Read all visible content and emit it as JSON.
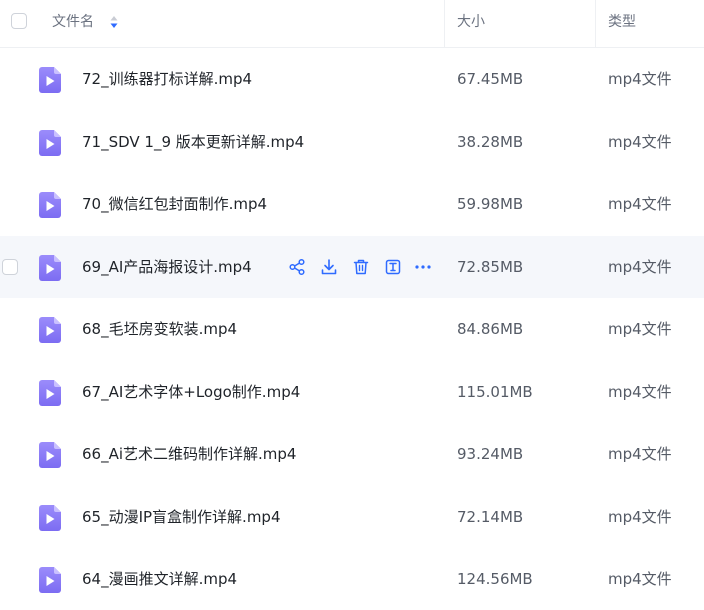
{
  "header": {
    "name_label": "文件名",
    "size_label": "大小",
    "type_label": "类型"
  },
  "colors": {
    "accent": "#2f6bff",
    "file_icon": "#8b7cf6"
  },
  "files": [
    {
      "name": "72_训练器打标详解.mp4",
      "size": "67.45MB",
      "type": "mp4文件"
    },
    {
      "name": "71_SDV 1_9 版本更新详解.mp4",
      "size": "38.28MB",
      "type": "mp4文件"
    },
    {
      "name": "70_微信红包封面制作.mp4",
      "size": "59.98MB",
      "type": "mp4文件"
    },
    {
      "name": "69_AI产品海报设计.mp4",
      "size": "72.85MB",
      "type": "mp4文件",
      "hovered": true
    },
    {
      "name": "68_毛坯房变软装.mp4",
      "size": "84.86MB",
      "type": "mp4文件"
    },
    {
      "name": "67_AI艺术字体+Logo制作.mp4",
      "size": "115.01MB",
      "type": "mp4文件"
    },
    {
      "name": "66_Ai艺术二维码制作详解.mp4",
      "size": "93.24MB",
      "type": "mp4文件"
    },
    {
      "name": "65_动漫IP盲盒制作详解.mp4",
      "size": "72.14MB",
      "type": "mp4文件"
    },
    {
      "name": "64_漫画推文详解.mp4",
      "size": "124.56MB",
      "type": "mp4文件"
    }
  ],
  "row_actions": [
    {
      "icon": "share-icon"
    },
    {
      "icon": "download-icon"
    },
    {
      "icon": "delete-icon"
    },
    {
      "icon": "rename-icon"
    },
    {
      "icon": "more-icon"
    }
  ]
}
